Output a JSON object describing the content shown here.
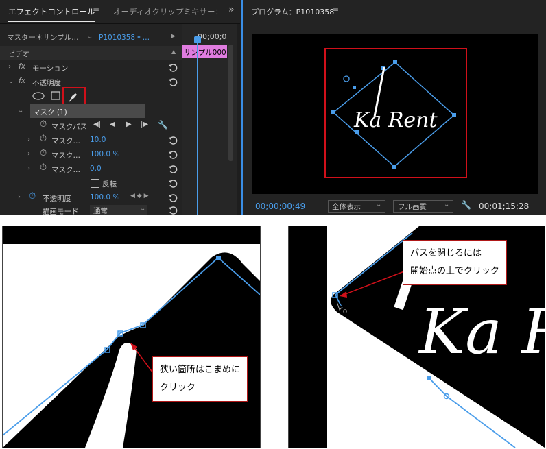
{
  "tabs": {
    "effect_controls": "エフェクトコントロール",
    "audio_mixer": "オーディオクリップミキサー：",
    "expand": "»"
  },
  "effect": {
    "master": "マスター＊サンプル…",
    "clip": "P1010358＊…",
    "timecode": "00;00;0",
    "clip_bar": "サンプル000",
    "video": "ビデオ",
    "motion": "モーション",
    "opacity": "不透明度",
    "fx": "fx",
    "mask": "マスク (1)",
    "mask_path": "マスクパス",
    "feather_label": "マスク…",
    "feather_value": "10.0",
    "opacity_label": "マスク…",
    "opacity_value": "100.0 %",
    "expansion_label": "マスク…",
    "expansion_value": "0.0",
    "invert": "反転",
    "opacity_prop": "不透明度",
    "opacity_prop_value": "100.0 %",
    "blend_mode": "描画モード",
    "blend_value": "通常"
  },
  "program": {
    "title": "プログラム：P1010358",
    "timecode": "00;00;00;49",
    "view": "全体表示",
    "quality": "フル画質",
    "duration": "00;01;15;28",
    "logo_text": "Ka Rent"
  },
  "callouts": {
    "left": [
      "狭い箇所はこまめに",
      "クリック"
    ],
    "right": [
      "パスを閉じるには",
      "開始点の上でクリック"
    ]
  },
  "colors": {
    "accent": "#4a9dea",
    "highlight": "#d0101a",
    "clip_bar": "#e07ce0"
  }
}
